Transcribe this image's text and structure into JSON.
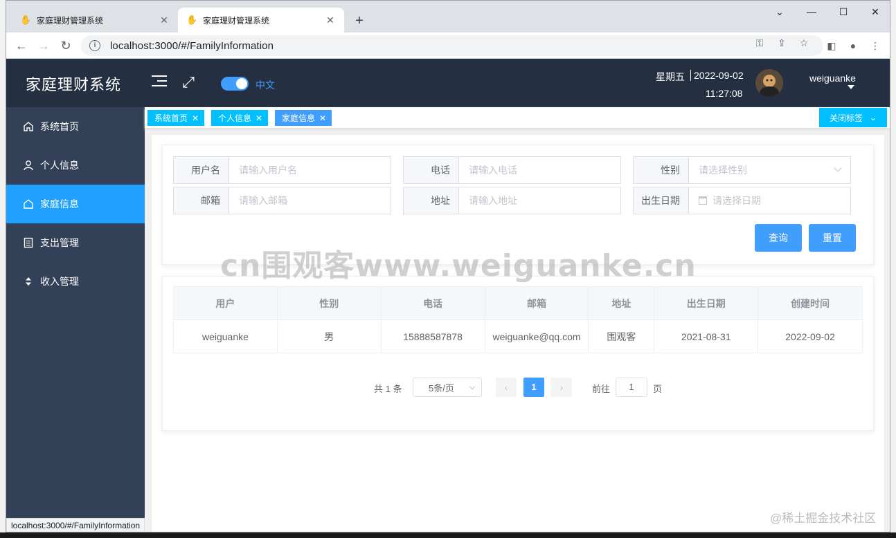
{
  "browser": {
    "tabs": [
      {
        "title": "家庭理财管理系统",
        "active": false
      },
      {
        "title": "家庭理财管理系统",
        "active": true
      }
    ],
    "url": "localhost:3000/#/FamilyInformation",
    "status_url": "localhost:3000/#/FamilyInformation"
  },
  "header": {
    "title": "家庭理财系统",
    "lang_label": "中文",
    "weekday": "星期五",
    "date": "2022-09-02",
    "time": "11:27:08",
    "username": "weiguanke"
  },
  "sidebar": {
    "items": [
      {
        "label": "系统首页",
        "icon": "home-icon"
      },
      {
        "label": "个人信息",
        "icon": "user-icon"
      },
      {
        "label": "家庭信息",
        "icon": "house-icon",
        "active": true
      },
      {
        "label": "支出管理",
        "icon": "document-icon"
      },
      {
        "label": "收入管理",
        "icon": "sort-icon"
      }
    ]
  },
  "tags": {
    "items": [
      {
        "label": "系统首页"
      },
      {
        "label": "个人信息"
      },
      {
        "label": "家庭信息",
        "active": true
      }
    ],
    "close_label": "关闭标签"
  },
  "search": {
    "fields": [
      {
        "label": "用户名",
        "placeholder": "请输入用户名"
      },
      {
        "label": "电话",
        "placeholder": "请输入电话"
      },
      {
        "label": "性别",
        "placeholder": "请选择性别"
      },
      {
        "label": "邮箱",
        "placeholder": "请输入邮箱"
      },
      {
        "label": "地址",
        "placeholder": "请输入地址"
      },
      {
        "label": "出生日期",
        "placeholder": "请选择日期"
      }
    ],
    "query_label": "查询",
    "reset_label": "重置"
  },
  "table": {
    "columns": [
      "用户",
      "性别",
      "电话",
      "邮箱",
      "地址",
      "出生日期",
      "创建时间"
    ],
    "rows": [
      [
        "weiguanke",
        "男",
        "15888587878",
        "weiguanke@qq.com",
        "围观客",
        "2021-08-31",
        "2022-09-02"
      ]
    ]
  },
  "pagination": {
    "total_text": "共 1 条",
    "page_size": "5条/页",
    "current_page": "1",
    "goto_label": "前往",
    "goto_value": "1",
    "goto_suffix": "页"
  },
  "watermark": "cn围观客www.weiguanke.cn",
  "credit": "@稀土掘金技术社区",
  "colors": {
    "header_bg": "#242f42",
    "sidebar_bg": "#324157",
    "sidebar_active": "#20a0ff",
    "tag_bg": "#00c0ff",
    "primary": "#409eff"
  }
}
